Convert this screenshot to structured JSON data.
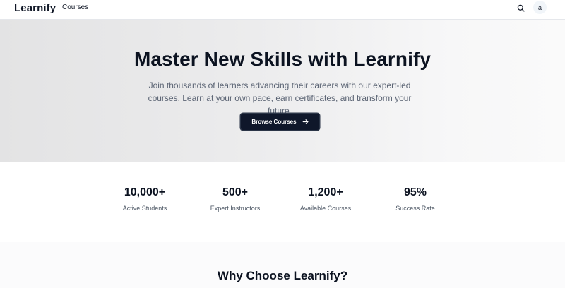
{
  "header": {
    "brand": "Learnify",
    "nav": [
      {
        "label": "Courses"
      }
    ],
    "search_icon": "search-icon",
    "avatar_initial": "a"
  },
  "hero": {
    "title": "Master New Skills with Learnify",
    "subtitle_line1": "Join thousands of learners advancing their careers with our expert-led",
    "subtitle_line2": "courses. Learn at your own pace, earn certificates, and transform your future.",
    "cta_label": "Browse Courses",
    "cta_icon": "arrow-right-icon"
  },
  "stats": [
    {
      "value": "10,000+",
      "label": "Active Students"
    },
    {
      "value": "500+",
      "label": "Expert Instructors"
    },
    {
      "value": "1,200+",
      "label": "Available Courses"
    },
    {
      "value": "95%",
      "label": "Success Rate"
    }
  ],
  "why": {
    "title": "Why Choose Learnify?"
  },
  "colors": {
    "primary_button": "#0f172a",
    "hero_bg_start": "#e3e3e4",
    "hero_bg_end": "#fafafa"
  }
}
